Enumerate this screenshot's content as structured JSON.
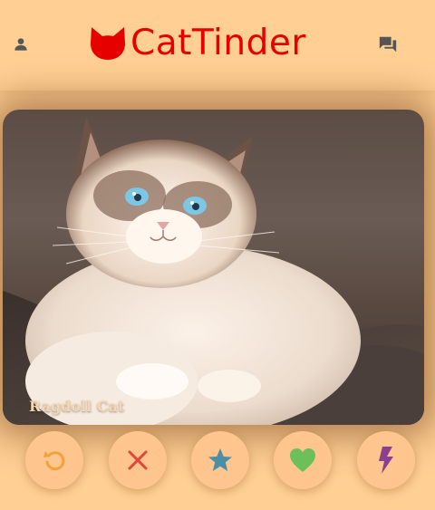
{
  "app": {
    "title": "CatTinder"
  },
  "header": {
    "profile_icon": "person-icon",
    "logo_icon": "cat-head-icon",
    "chat_icon": "chat-bubbles-icon"
  },
  "card": {
    "name": "Ragdoll Cat"
  },
  "actions": [
    {
      "id": "rewind",
      "icon": "undo-icon",
      "color": "#f0a23c"
    },
    {
      "id": "nope",
      "icon": "close-icon",
      "color": "#e0463a"
    },
    {
      "id": "super-like",
      "icon": "star-icon",
      "color": "#4b8fa6"
    },
    {
      "id": "like",
      "icon": "heart-icon",
      "color": "#6cbf5a"
    },
    {
      "id": "boost",
      "icon": "lightning-icon",
      "color": "#8a3f8f"
    }
  ],
  "colors": {
    "background": "#ffcf94",
    "brand": "#e60000",
    "button_bg": "#ffc58f"
  }
}
